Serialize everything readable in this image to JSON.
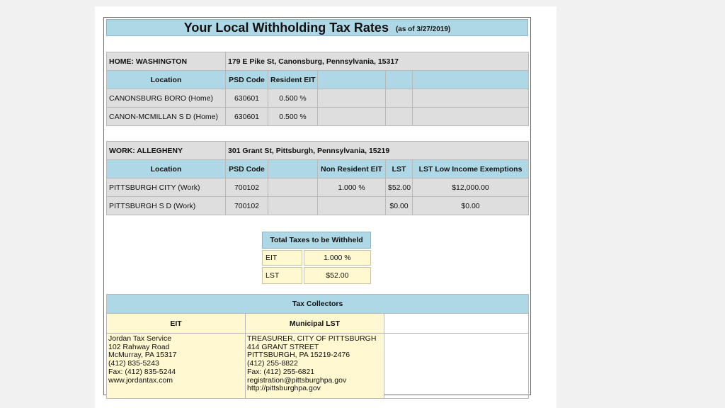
{
  "title": "Your Local Withholding Tax Rates",
  "as_of": "(as of 3/27/2019)",
  "home": {
    "label": "HOME: WASHINGTON",
    "address": "179 E Pike St, Canonsburg, Pennsylvania, 15317",
    "headers": [
      "Location",
      "PSD Code",
      "Resident EIT"
    ],
    "rows": [
      {
        "location": "CANONSBURG BORO (Home)",
        "psd": "630601",
        "eit": "0.500 %"
      },
      {
        "location": "CANON-MCMILLAN S D (Home)",
        "psd": "630601",
        "eit": "0.500 %"
      }
    ]
  },
  "work": {
    "label": "WORK: ALLEGHENY",
    "address": "301 Grant St, Pittsburgh, Pennsylvania, 15219",
    "headers": [
      "Location",
      "PSD Code",
      "Non Resident EIT",
      "LST",
      "LST Low Income Exemptions"
    ],
    "rows": [
      {
        "location": "PITTSBURGH CITY (Work)",
        "psd": "700102",
        "eit": "1.000 %",
        "lst": "$52.00",
        "exempt": "$12,000.00"
      },
      {
        "location": "PITTSBURGH S D (Work)",
        "psd": "700102",
        "eit": "",
        "lst": "$0.00",
        "exempt": "$0.00"
      }
    ]
  },
  "totals": {
    "header": "Total Taxes to be Withheld",
    "rows": [
      {
        "label": "EIT",
        "value": "1.000 %"
      },
      {
        "label": "LST",
        "value": "$52.00"
      }
    ]
  },
  "collectors": {
    "header": "Tax Collectors",
    "eit_header": "EIT",
    "lst_header": "Municipal LST",
    "eit_address": "Jordan Tax Service\n102 Rahway Road\nMcMurray, PA 15317\n(412) 835-5243\nFax: (412) 835-5244\nwww.jordantax.com",
    "lst_address": "TREASURER, CITY OF PITTSBURGH\n414 GRANT STREET\nPITTSBURGH, PA 15219-2476\n(412) 255-8822\nFax: (412) 255-6821\nregistration@pittsburghpa.gov\nhttp://pittsburghpa.gov"
  },
  "colors": {
    "header_blue": "#aed8e6",
    "row_gray": "#dedede",
    "yellow": "#fff8d0"
  }
}
